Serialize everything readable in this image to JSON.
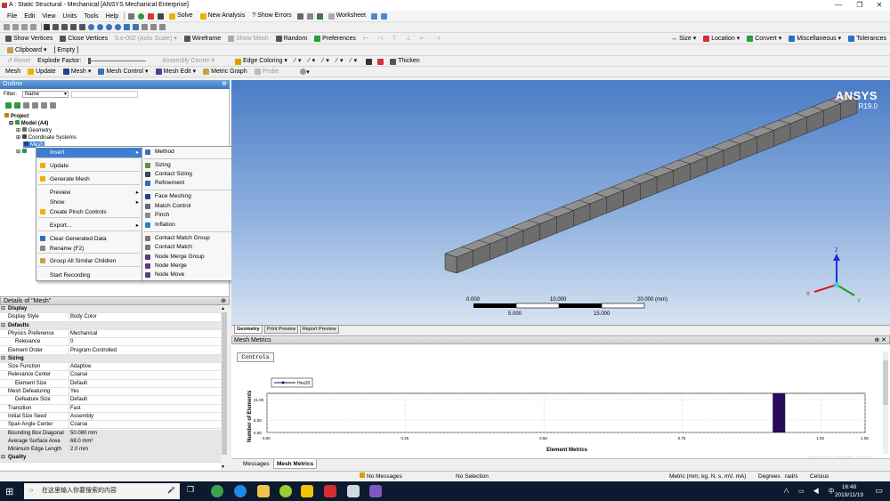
{
  "window": {
    "title": "A : Static Structural - Mechanical [ANSYS Mechanical Enterprise]"
  },
  "menu": [
    "File",
    "Edit",
    "View",
    "Units",
    "Tools",
    "Help"
  ],
  "toolbar1": {
    "solve": "Solve",
    "new_analysis": "New Analysis",
    "show_errors": "Show Errors",
    "worksheet": "Worksheet"
  },
  "toolbar2": {
    "show_vertices": "Show Vertices",
    "close_vertices": "Close Vertices",
    "scale": "5.e-002 (Auto Scale)",
    "wireframe": "Wireframe",
    "show_mesh": "Show Mesh",
    "random": "Random",
    "preferences": "Preferences",
    "size": "Size",
    "location": "Location",
    "convert": "Convert",
    "miscellaneous": "Miscellaneous",
    "tolerances": "Tolerances"
  },
  "toolbar3": {
    "clipboard": "Clipboard",
    "empty": "[ Empty ]"
  },
  "toolbar4": {
    "reset": "Reset",
    "explode_factor": "Explode Factor:",
    "assembly_center": "Assembly Center"
  },
  "toolbar5": {
    "mesh": "Mesh",
    "update": "Update",
    "mesh_dd": "Mesh",
    "mesh_control": "Mesh Control",
    "mesh_edit": "Mesh Edit",
    "metric_graph": "Metric Graph",
    "probe": "Probe",
    "edge_coloring": "Edge Coloring",
    "thicken": "Thicken"
  },
  "outline": {
    "header": "Outline",
    "filter_label": "Filter:",
    "filter_value": "Name",
    "tree": [
      "Project",
      "Model (A4)",
      "Geometry",
      "Coordinate Systems",
      "Mesh"
    ]
  },
  "context_menu": [
    {
      "label": "Insert",
      "highlight": true,
      "arrow": true
    },
    {
      "label": "Update"
    },
    {
      "label": "Generate Mesh"
    },
    {
      "label": "Preview",
      "arrow": true
    },
    {
      "label": "Show",
      "arrow": true
    },
    {
      "label": "Create Pinch Controls"
    },
    {
      "label": "Export...",
      "arrow": true
    },
    {
      "label": "Clear Generated Data"
    },
    {
      "label": "Rename (F2)"
    },
    {
      "label": "Group All Similar Children"
    },
    {
      "label": "Start Recording"
    }
  ],
  "submenu": [
    {
      "label": "Method",
      "color": "#3a6fb0"
    },
    {
      "label": "Sizing",
      "color": "#5a8f3a"
    },
    {
      "label": "Contact Sizing",
      "color": "#444"
    },
    {
      "label": "Refinement",
      "color": "#2b6cb8"
    },
    {
      "label": "Face Meshing",
      "color": "#2a3f8f"
    },
    {
      "label": "Match Control",
      "color": "#666"
    },
    {
      "label": "Pinch",
      "color": "#888"
    },
    {
      "label": "Inflation",
      "color": "#2a7fc0"
    },
    {
      "label": "Contact Match Group",
      "color": "#777"
    },
    {
      "label": "Contact Match",
      "color": "#777"
    },
    {
      "label": "Node Merge Group",
      "color": "#5b3b8a"
    },
    {
      "label": "Node Merge",
      "color": "#5b3b8a"
    },
    {
      "label": "Node Move",
      "color": "#5b3b8a"
    }
  ],
  "details": {
    "header": "Details of \"Mesh\"",
    "rows": [
      {
        "t": "cat",
        "k": "Display"
      },
      {
        "k": "Display Style",
        "v": "Body Color"
      },
      {
        "t": "cat",
        "k": "Defaults"
      },
      {
        "k": "Physics Preference",
        "v": "Mechanical"
      },
      {
        "t": "sub",
        "k": "Relevance",
        "v": "0"
      },
      {
        "k": "Element Order",
        "v": "Program Controlled"
      },
      {
        "t": "cat",
        "k": "Sizing"
      },
      {
        "k": "Size Function",
        "v": "Adaptive"
      },
      {
        "k": "Relevance Center",
        "v": "Coarse"
      },
      {
        "t": "sub",
        "k": "Element Size",
        "v": "Default"
      },
      {
        "k": "Mesh Defeaturing",
        "v": "Yes"
      },
      {
        "t": "sub",
        "k": "Defeature Size",
        "v": "Default"
      },
      {
        "k": "Transition",
        "v": "Fast"
      },
      {
        "k": "Initial Size Seed",
        "v": "Assembly"
      },
      {
        "k": "Span Angle Center",
        "v": "Coarse"
      },
      {
        "t": "hi",
        "k": "Bounding Box Diagonal",
        "v": "50.080 mm"
      },
      {
        "t": "hi",
        "k": "Average Surface Area",
        "v": "68.0 mm²"
      },
      {
        "t": "hi",
        "k": "Minimum Edge Length",
        "v": "2.0 mm"
      },
      {
        "t": "cat",
        "k": "Quality"
      }
    ]
  },
  "viewport": {
    "brand": "ANSYS",
    "version": "R19.0",
    "scale_top": [
      "0.000",
      "10.000",
      "20.000 (mm)"
    ],
    "scale_bottom": [
      "5.000",
      "15.000"
    ],
    "axes": {
      "x": "X",
      "y": "Y",
      "z": "Z"
    }
  },
  "view_tabs": [
    "Geometry",
    "Print Preview",
    "Report Preview"
  ],
  "mesh_metrics": {
    "header": "Mesh Metrics",
    "controls_button": "Controls",
    "legend": "Hex20",
    "ylabel": "Number of Elements",
    "xlabel": "Element Metrics",
    "yticks": [
      "21.00",
      "8.00",
      "0.00"
    ],
    "xticks": [
      "0.00",
      "0.25",
      "0.50",
      "0.75",
      "1.00",
      "1.08"
    ]
  },
  "chart_data": {
    "type": "bar",
    "title": "",
    "xlabel": "Element Metrics",
    "ylabel": "Number of Elements",
    "series": [
      {
        "name": "Hex20",
        "x": [
          1.0
        ],
        "values": [
          25
        ]
      }
    ],
    "xlim": [
      0,
      1.08
    ],
    "ylim": [
      0,
      25
    ]
  },
  "bottom_tabs": [
    "Messages",
    "Mesh Metrics"
  ],
  "status": {
    "messages": "No Messages",
    "selection": "No Selection",
    "units": "Metric (mm, kg, N, s, mV, mA)",
    "degrees": "Degrees",
    "rad": "rad/s",
    "celsius": "Celsius"
  },
  "taskbar": {
    "search_placeholder": "在这里输入你要搜索的内容",
    "time": "16:48",
    "date": "2019/11/19"
  },
  "watermark": "jingyan.baidu.com"
}
